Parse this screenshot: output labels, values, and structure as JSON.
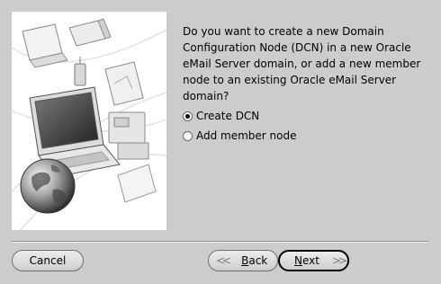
{
  "question": "Do you want to create a new Domain Configuration Node (DCN) in a new Oracle eMail Server domain, or add a new member node to an existing Oracle eMail Server domain?",
  "options": [
    {
      "label": "Create DCN",
      "selected": true
    },
    {
      "label": "Add member node",
      "selected": false
    }
  ],
  "buttons": {
    "cancel": "Cancel",
    "back": {
      "mnemonic": "B",
      "rest": "ack"
    },
    "next": {
      "mnemonic": "N",
      "rest": "ext"
    }
  }
}
